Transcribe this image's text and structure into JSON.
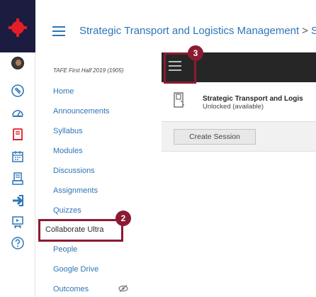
{
  "header": {
    "breadcrumb": [
      {
        "label": "Strategic Transport and Logistics Management"
      },
      {
        "label": "St"
      }
    ],
    "separator": ">"
  },
  "course_nav": {
    "term": "TAFE First Half 2019 (1905)",
    "items": [
      {
        "label": "Home"
      },
      {
        "label": "Announcements"
      },
      {
        "label": "Syllabus"
      },
      {
        "label": "Modules"
      },
      {
        "label": "Discussions"
      },
      {
        "label": "Assignments"
      },
      {
        "label": "Quizzes"
      },
      {
        "label": "Collaborate Ultra",
        "active": true
      },
      {
        "label": "People"
      },
      {
        "label": "Google Drive"
      },
      {
        "label": "Outcomes",
        "hidden_icon": "eye-off-icon"
      }
    ]
  },
  "content": {
    "session_title": "Strategic Transport and Logis",
    "session_status": "Unlocked (available)",
    "create_button": "Create Session"
  },
  "callouts": {
    "nav_callout": "2",
    "menu_callout": "3"
  },
  "colors": {
    "link": "#2d75b8",
    "brand_red": "#e41e26",
    "rail_icon": "#2d75b8",
    "callout": "#8b1a33",
    "dark_bar": "#262626"
  }
}
